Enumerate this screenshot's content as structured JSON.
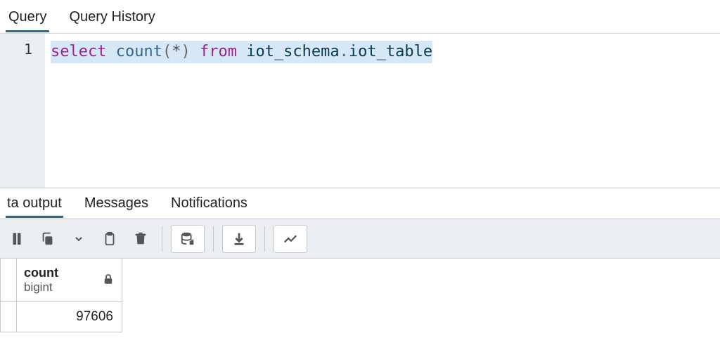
{
  "topTabs": [
    {
      "label": "Query",
      "active": true
    },
    {
      "label": "Query History",
      "active": false
    }
  ],
  "editor": {
    "lineNumber": "1",
    "tokens": {
      "kw_select": "select",
      "fn_count": "count",
      "paren_open": "(",
      "star": "*",
      "paren_close": ")",
      "kw_from": "from",
      "ident_schema": "iot_schema",
      "dot": ".",
      "ident_table": "iot_table"
    }
  },
  "resultTabs": [
    {
      "label": "ta output",
      "active": true
    },
    {
      "label": "Messages",
      "active": false
    },
    {
      "label": "Notifications",
      "active": false
    }
  ],
  "columns": [
    {
      "name": "count",
      "type": "bigint",
      "readonly": true
    }
  ],
  "rows": [
    {
      "count": "97606"
    }
  ]
}
